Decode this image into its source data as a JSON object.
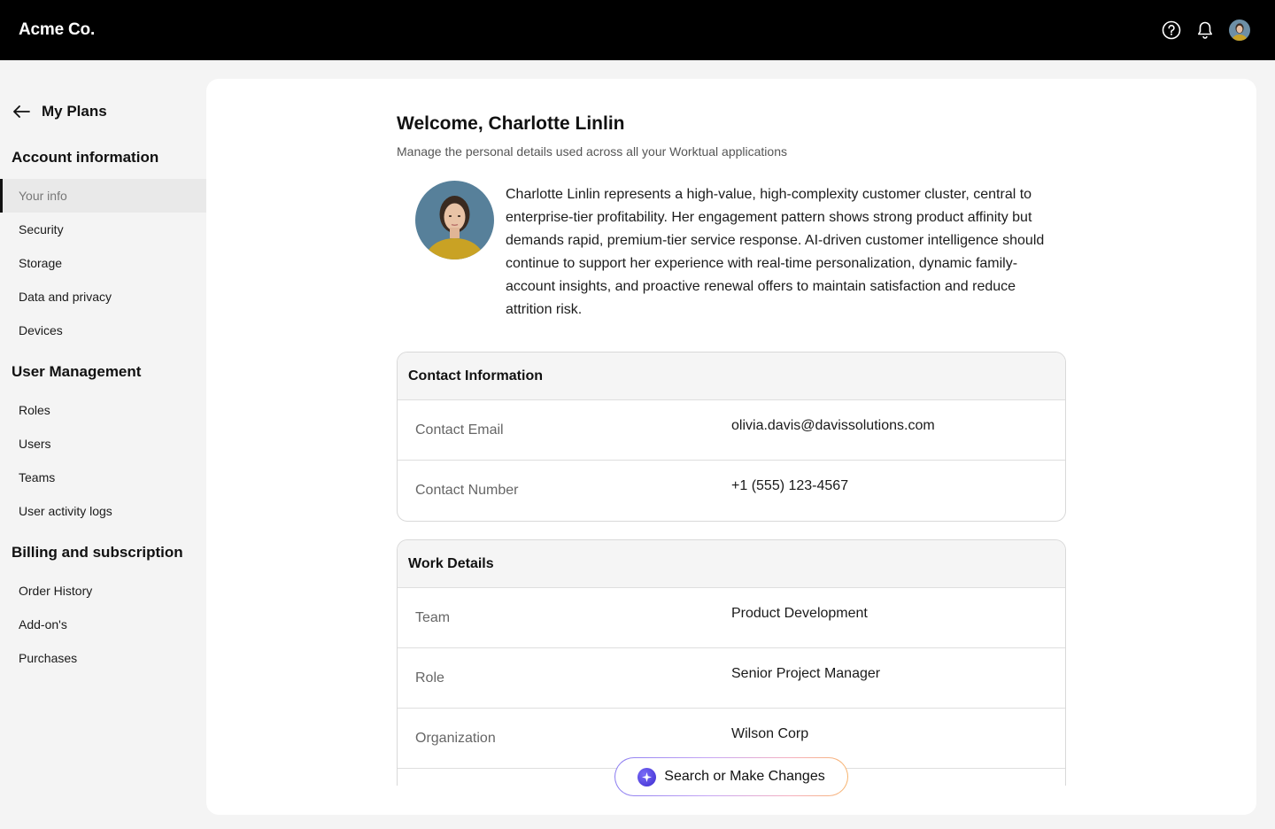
{
  "app": {
    "brand": "Acme Co."
  },
  "topbar": {
    "icons": [
      "help-icon",
      "bell-icon"
    ],
    "avatar": "user-avatar"
  },
  "sidebar": {
    "back_label": "My Plans",
    "sections": [
      {
        "title": "Account information",
        "items": [
          "Your info",
          "Security",
          "Storage",
          "Data and privacy",
          "Devices"
        ]
      },
      {
        "title": "User Management",
        "items": [
          "Roles",
          "Users",
          "Teams",
          "User activity logs"
        ]
      },
      {
        "title": "Billing and subscription",
        "items": [
          "Order History",
          "Add-on's",
          "Purchases"
        ]
      }
    ],
    "active_item": "Your info"
  },
  "main": {
    "welcome": "Welcome, Charlotte Linlin",
    "subtitle": "Manage the personal details used across all your Worktual applications",
    "bio": "Charlotte Linlin represents a high-value, high-complexity customer cluster, central to enterprise-tier profitability. Her engagement pattern shows strong product affinity but demands rapid, premium-tier service response. AI-driven customer intelligence should continue to support her experience with real-time personalization, dynamic family-account insights, and proactive renewal offers to maintain satisfaction and reduce attrition risk.",
    "contact": {
      "title": "Contact Information",
      "rows": [
        {
          "label": "Contact Email",
          "value": "olivia.davis@davissolutions.com"
        },
        {
          "label": "Contact Number",
          "value": "+1 (555) 123-4567"
        }
      ]
    },
    "work": {
      "title": "Work Details",
      "rows": [
        {
          "label": "Team",
          "value": "Product Development"
        },
        {
          "label": "Role",
          "value": "Senior Project Manager"
        },
        {
          "label": "Organization",
          "value": "Wilson Corp"
        }
      ]
    }
  },
  "assistant": {
    "label": "Search or Make Changes",
    "icon": "sparkle-icon"
  }
}
